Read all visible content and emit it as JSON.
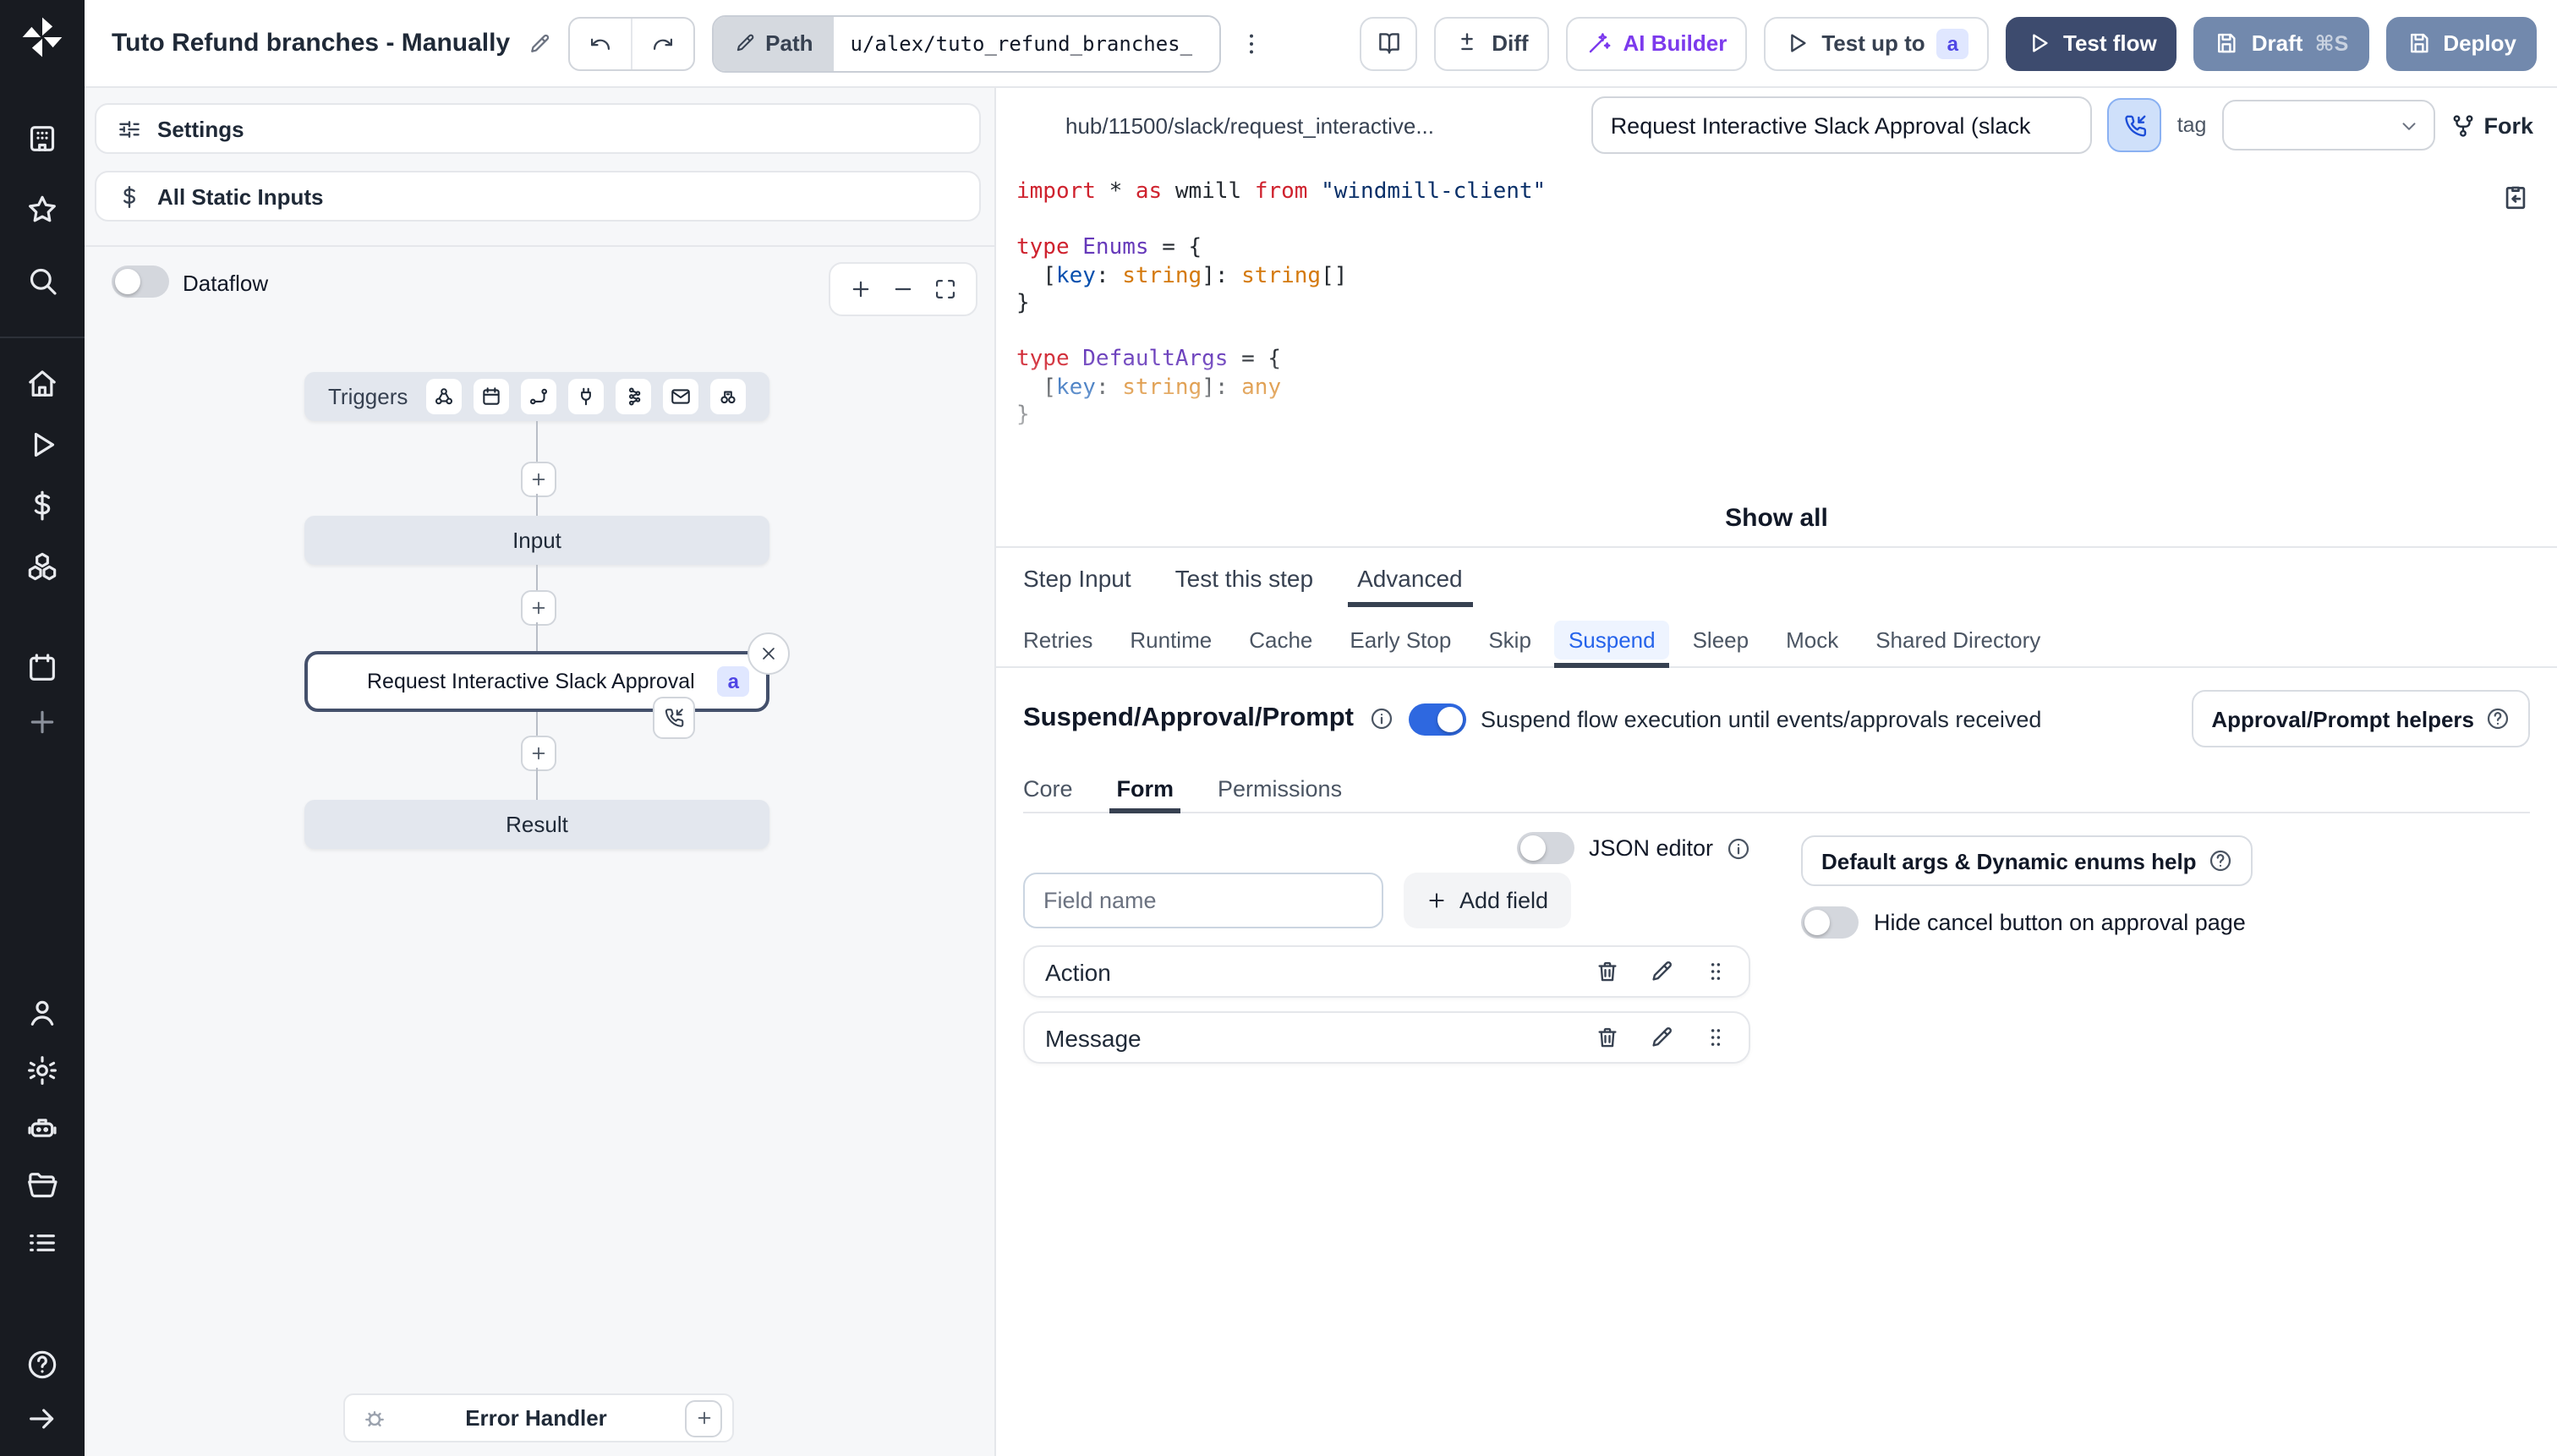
{
  "topbar": {
    "title": "Tuto Refund branches - Manually",
    "path_label": "Path",
    "path_value": "u/alex/tuto_refund_branches_",
    "diff_label": "Diff",
    "ai_builder_label": "AI Builder",
    "test_up_to_label": "Test up to",
    "test_up_to_badge": "a",
    "test_flow_label": "Test flow",
    "draft_label": "Draft",
    "draft_shortcut": "⌘S",
    "deploy_label": "Deploy"
  },
  "sidebar": {
    "top": [
      {
        "id": "workspace",
        "icon": "building-icon"
      },
      {
        "id": "favorites",
        "icon": "star-icon"
      },
      {
        "id": "search",
        "icon": "search-icon"
      }
    ],
    "main": [
      {
        "id": "home",
        "icon": "home-icon"
      },
      {
        "id": "runs",
        "icon": "play-icon"
      },
      {
        "id": "variables",
        "icon": "dollar-icon"
      },
      {
        "id": "resources",
        "icon": "cubes-icon"
      },
      {
        "id": "schedules",
        "icon": "calendar-icon"
      },
      {
        "id": "add",
        "icon": "plus-icon",
        "dim": true
      }
    ],
    "bottom": [
      {
        "id": "users",
        "icon": "user-icon"
      },
      {
        "id": "settings",
        "icon": "gear-icon"
      },
      {
        "id": "workers",
        "icon": "robot-icon"
      },
      {
        "id": "folders",
        "icon": "folder-icon"
      },
      {
        "id": "audit-logs",
        "icon": "list-icon"
      }
    ],
    "footer": [
      {
        "id": "help",
        "icon": "help-icon"
      },
      {
        "id": "expand",
        "icon": "arrow-right-icon"
      }
    ]
  },
  "flow_panel": {
    "settings_label": "Settings",
    "static_inputs_label": "All Static Inputs",
    "dataflow_label": "Dataflow",
    "triggers_label": "Triggers",
    "trigger_icons": [
      "webhook-icon",
      "schedule-icon",
      "route-icon",
      "websocket-icon",
      "kafka-icon",
      "email-icon",
      "poll-icon"
    ],
    "input_label": "Input",
    "step_label": "Request Interactive Slack Approval (...",
    "step_badge": "a",
    "result_label": "Result",
    "error_handler_label": "Error Handler"
  },
  "editor": {
    "hub_path": "hub/11500/slack/request_interactive...",
    "summary_value": "Request Interactive Slack Approval (slack",
    "tag_label": "tag",
    "fork_label": "Fork",
    "show_all_label": "Show all",
    "code": [
      [
        [
          "k",
          "import"
        ],
        [
          "p",
          " * "
        ],
        [
          "k",
          "as"
        ],
        [
          "p",
          " wmill "
        ],
        [
          "k",
          "from"
        ],
        [
          "s",
          " \"windmill-client\""
        ]
      ],
      [],
      [
        [
          "k",
          "type"
        ],
        [
          "t",
          " Enums"
        ],
        [
          "p",
          " = {"
        ]
      ],
      [
        [
          "p",
          "  ["
        ],
        [
          "v",
          "key"
        ],
        [
          "p",
          ": "
        ],
        [
          "ty",
          "string"
        ],
        [
          "p",
          "]: "
        ],
        [
          "ty",
          "string"
        ],
        [
          "p",
          "[]"
        ]
      ],
      [
        [
          "p",
          "}"
        ]
      ],
      [],
      [
        [
          "k",
          "type"
        ],
        [
          "t",
          " DefaultArgs"
        ],
        [
          "p",
          " = {"
        ]
      ],
      [
        [
          "p",
          "  ["
        ],
        [
          "v",
          "key"
        ],
        [
          "p",
          ": "
        ],
        [
          "ty",
          "string"
        ],
        [
          "p",
          "]: "
        ],
        [
          "ty",
          "any"
        ]
      ],
      [
        [
          "p",
          "}"
        ]
      ]
    ]
  },
  "tabs": {
    "items": [
      "Step Input",
      "Test this step",
      "Advanced"
    ],
    "active": "Advanced"
  },
  "advanced_tabs": {
    "items": [
      "Retries",
      "Runtime",
      "Cache",
      "Early Stop",
      "Skip",
      "Suspend",
      "Sleep",
      "Mock",
      "Shared Directory"
    ],
    "active": "Suspend"
  },
  "suspend": {
    "title": "Suspend/Approval/Prompt",
    "toggle_on": true,
    "description": "Suspend flow execution until events/approvals received",
    "helpers_label": "Approval/Prompt helpers",
    "section_tabs": {
      "items": [
        "Core",
        "Form",
        "Permissions"
      ],
      "active": "Form"
    },
    "json_editor_label": "JSON editor",
    "field_name_placeholder": "Field name",
    "add_field_label": "Add field",
    "fields": [
      {
        "name": "Action"
      },
      {
        "name": "Message"
      }
    ],
    "default_args_help_label": "Default args & Dynamic enums help",
    "hide_cancel_label": "Hide cancel button on approval page"
  },
  "colors": {
    "accent_blue": "#2563eb",
    "primary_navy": "#3d4b6e",
    "slate_button": "#7289ad",
    "ai_purple": "#7c3aed",
    "badge_bg": "#e0e7ff",
    "sidebar_bg": "#181b21",
    "canvas_bg": "#f6f7f9",
    "node_bg": "#e3e7ee",
    "selected_border": "#44506b"
  }
}
